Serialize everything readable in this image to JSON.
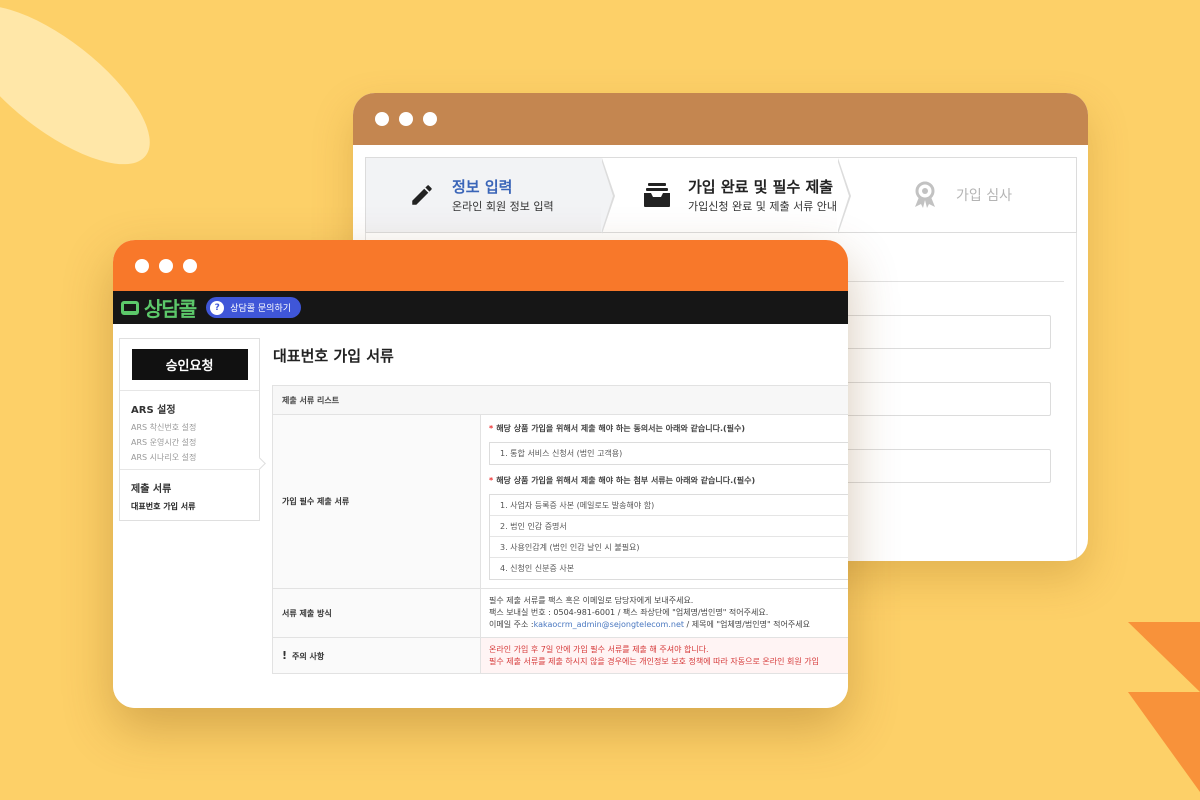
{
  "back_window": {
    "steps": [
      {
        "title": "정보 입력",
        "subtitle": "온라인 회원 정보 입력",
        "icon": "pencil-icon"
      },
      {
        "title": "가입 완료 및 필수 제출",
        "subtitle": "가입신청 완료 및 제출 서류 안내",
        "icon": "inbox-icon"
      },
      {
        "title": "가입 심사",
        "subtitle": "",
        "icon": "award-icon"
      }
    ]
  },
  "front_window": {
    "logo_text": "상담콜",
    "inquiry_button": {
      "icon_text": "?",
      "label": "상담콜 문의하기"
    },
    "sidebar": {
      "approve_button": "승인요청",
      "groups": [
        {
          "heading": "ARS 설정",
          "items": [
            "ARS 착신번호 설정",
            "ARS 운영시간 설정",
            "ARS 시나리오 설정"
          ]
        },
        {
          "heading": "제출 서류",
          "items": [
            "대표번호 가입 서류"
          ],
          "active_item": "대표번호 가입 서류"
        }
      ]
    },
    "main": {
      "title": "대표번호 가입 서류",
      "table_header": "제출 서류 리스트",
      "required_docs": {
        "label": "가입 필수 제출 서류",
        "consent_title": "해당 상품 가입을 위해서 제출 해야 하는 동의서는 아래와 같습니다.(필수)",
        "consent_items": [
          "1. 통합 서비스 신청서 (법인 고객용)"
        ],
        "attach_title": "해당 상품 가입을 위해서 제출 해야 하는 첨부 서류는 아래와 같습니다.(필수)",
        "attach_items": [
          "1. 사업자 등록증 사본 (메일로도 발송해야 함)",
          "2. 법인 인감 증명서",
          "3. 사용인감계 (법인 인감 날인 시 불필요)",
          "4. 신청인 신분증 사본"
        ]
      },
      "submit_method": {
        "label": "서류 제출 방식",
        "line1": "필수 제출 서류를 팩스 혹은 이메일로 담당자에게 보내주세요.",
        "line2": "팩스 보내실 번호 : 0504-981-6001 / 팩스 좌상단에 \"업체명/법인명\" 적어주세요.",
        "line3_prefix": "이메일 주소 :",
        "email": "kakaocrm_admin@sejongtelecom.net",
        "line3_suffix": "/ 제목에 \"업체명/법인명\" 적어주세요"
      },
      "notice": {
        "label": "주의 사항",
        "line1": "온라인 가입 후 7일 안에 가입 필수 서류를 제출 해 주셔야 합니다.",
        "line2": "필수 제출 서류를 제출 하시지 않을 경우에는 개인정보 보호 정책에 따라 자동으로 온라인 회원 가입"
      }
    }
  }
}
